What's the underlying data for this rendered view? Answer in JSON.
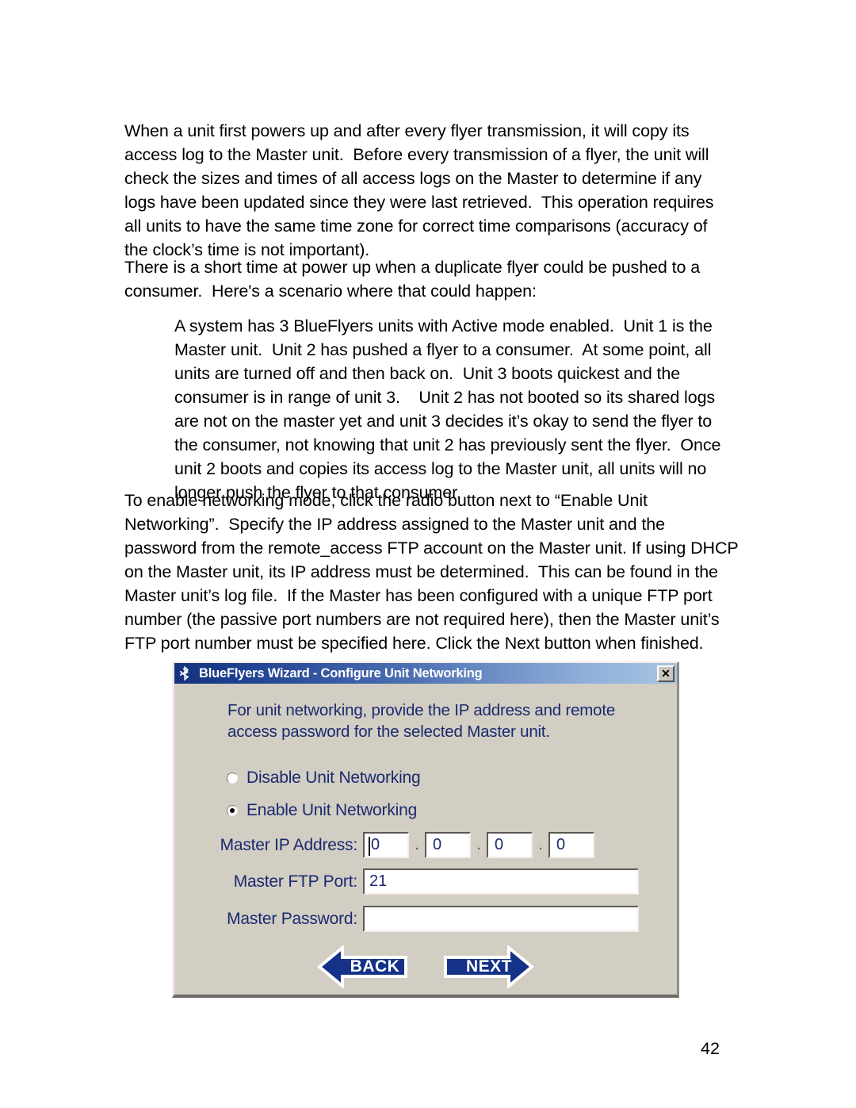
{
  "document": {
    "paragraphs": [
      "When a unit first powers up and after every flyer transmission, it will copy its access log to the Master unit.  Before every transmission of a flyer, the unit will check the sizes and times of all access logs on the Master to determine if any logs have been updated since they were last retrieved.  This operation requires all units to have the same time zone for correct time comparisons (accuracy of the clock’s time is not important).",
      "There is a short time at power up when a duplicate flyer could be pushed to a consumer.  Here's a scenario where that could happen:",
      "A system has 3 BlueFlyers units with Active mode enabled.  Unit 1 is the Master unit.  Unit 2 has pushed a flyer to a consumer.  At some point, all units are turned off and then back on.  Unit 3 boots quickest and the consumer is in range of unit 3.    Unit 2 has not booted so its shared logs are not on the master yet and unit 3 decides it’s okay to send the flyer to the consumer, not knowing that unit 2 has previously sent the flyer.  Once unit 2 boots and copies its access log to the Master unit, all units will no longer push the flyer to that consumer.",
      "To enable networking mode, click the radio button next to “Enable Unit Networking”.  Specify the IP address assigned to the Master unit and the password from the remote_access FTP account on the Master unit. If using DHCP on the Master unit, its IP address must be determined.  This can be found in the Master unit’s log file.  If the Master has been configured with a unique FTP port number (the passive port numbers are not required here), then the Master unit’s FTP port number must be specified here. Click the Next button when finished."
    ],
    "page_number": "42"
  },
  "dialog": {
    "title": "BlueFlyers Wizard - Configure Unit Networking",
    "title_icon": "bluetooth-icon",
    "close_label": "✕",
    "instruction": "For unit networking, provide the IP address and remote access password for the selected Master unit.",
    "radios": [
      {
        "label": "Disable Unit Networking",
        "selected": false
      },
      {
        "label": "Enable Unit Networking",
        "selected": true
      }
    ],
    "fields": {
      "ip": {
        "label": "Master IP Address:",
        "separator": ".",
        "octets": [
          "0",
          "0",
          "0",
          "0"
        ],
        "placeholder": ""
      },
      "port": {
        "label": "Master FTP Port:",
        "value": "21",
        "placeholder": ""
      },
      "password": {
        "label": "Master Password:",
        "value": "",
        "placeholder": ""
      }
    },
    "buttons": {
      "back": "BACK",
      "next": "NEXT"
    },
    "colors": {
      "title_bar_start": "#15327c",
      "title_bar_end": "#a9c4e3",
      "dialog_face": "#d2cec4",
      "label_text": "#1a2a6e",
      "arrow_button": "#153288"
    }
  }
}
